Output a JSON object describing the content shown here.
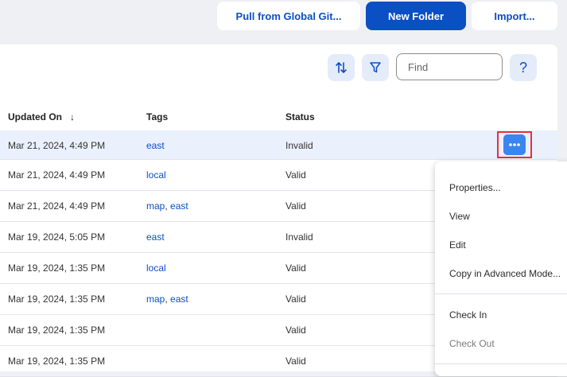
{
  "toolbar": {
    "pull_label": "Pull from Global Git...",
    "new_folder_label": "New Folder",
    "import_label": "Import..."
  },
  "find": {
    "placeholder": "Find",
    "value": ""
  },
  "icons": {
    "sort": "sort-arrows-icon",
    "filter": "funnel-filter-icon",
    "help": "question-icon",
    "more": "ellipsis-icon"
  },
  "help_label": "?",
  "columns": {
    "updated_on": "Updated On",
    "tags": "Tags",
    "status": "Status",
    "sort_indicator": "↓"
  },
  "rows": [
    {
      "updated": "Mar 21, 2024, 4:49 PM",
      "tags": [
        "east"
      ],
      "status": "Invalid"
    },
    {
      "updated": "Mar 21, 2024, 4:49 PM",
      "tags": [
        "local"
      ],
      "status": "Valid"
    },
    {
      "updated": "Mar 21, 2024, 4:49 PM",
      "tags": [
        "map",
        "east"
      ],
      "status": "Valid"
    },
    {
      "updated": "Mar 19, 2024, 5:05 PM",
      "tags": [
        "east"
      ],
      "status": "Invalid"
    },
    {
      "updated": "Mar 19, 2024, 1:35 PM",
      "tags": [
        "local"
      ],
      "status": "Valid"
    },
    {
      "updated": "Mar 19, 2024, 1:35 PM",
      "tags": [
        "map",
        "east"
      ],
      "status": "Valid"
    },
    {
      "updated": "Mar 19, 2024, 1:35 PM",
      "tags": [],
      "status": "Valid"
    },
    {
      "updated": "Mar 19, 2024, 1:35 PM",
      "tags": [],
      "status": "Valid"
    }
  ],
  "context_menu": {
    "properties": "Properties...",
    "view": "View",
    "edit": "Edit",
    "copy_advanced": "Copy in Advanced Mode...",
    "check_in": "Check In",
    "check_out": "Check Out"
  },
  "colors": {
    "accent": "#0b4fc4",
    "more_button": "#3a86f0",
    "highlight": "#e2323a"
  }
}
